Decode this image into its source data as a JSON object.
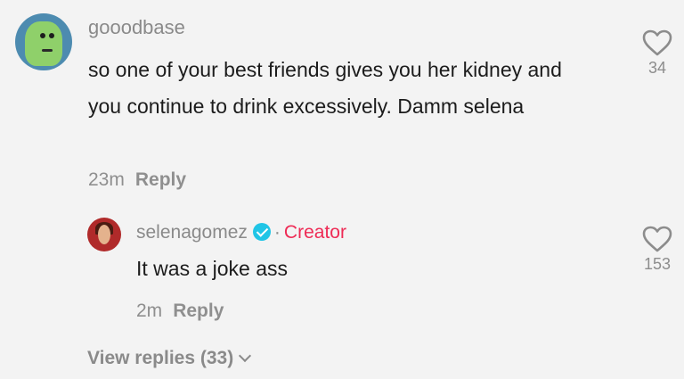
{
  "comment": {
    "username": "gooodbase",
    "text": "so one of your best friends gives you her kidney and you continue to drink excessively. Damm selena",
    "time": "23m",
    "reply_label": "Reply",
    "likes": "34",
    "avatar_icon": "frog-avatar"
  },
  "reply": {
    "username": "selenagomez",
    "badge_label": "Creator",
    "text": "It was a joke ass",
    "time": "2m",
    "reply_label": "Reply",
    "likes": "153",
    "verified_color": "#20c5e6",
    "creator_color": "#ee2b55"
  },
  "view_replies": "View replies (33)"
}
